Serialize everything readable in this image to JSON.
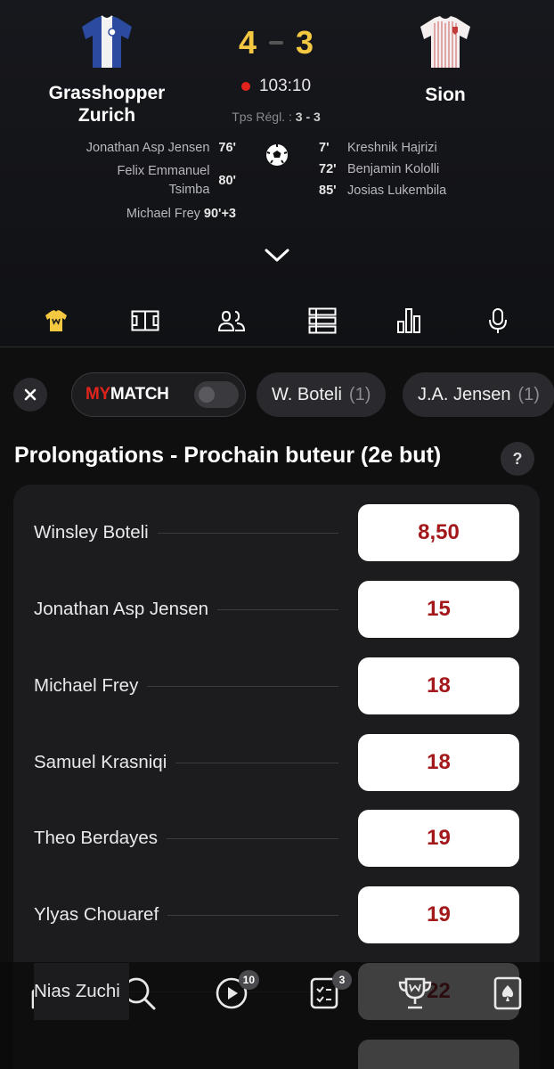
{
  "match": {
    "home_team": "Grasshopper Zurich",
    "away_team": "Sion",
    "home_score": "4",
    "away_score": "3",
    "clock": "103:10",
    "regulation_label": "Tps Régl. :",
    "regulation_score": "3 - 3",
    "home_scorers": [
      {
        "name": "Jonathan Asp Jensen",
        "minute": "76'"
      },
      {
        "name": "Felix Emmanuel Tsimba",
        "minute": "80'"
      },
      {
        "name": "Michael Frey",
        "minute": "90'+3"
      }
    ],
    "away_scorers": [
      {
        "name": "Kreshnik Hajrizi",
        "minute": "7'"
      },
      {
        "name": "Benjamin Kololli",
        "minute": "72'"
      },
      {
        "name": "Josias Lukembila",
        "minute": "85'"
      }
    ]
  },
  "tabs": [
    "jersey-icon",
    "pitch-icon",
    "lineups-icon",
    "standings-icon",
    "stats-icon",
    "microphone-icon"
  ],
  "filters": {
    "mymatch_prefix": "MY",
    "mymatch_suffix": "MATCH",
    "chips": [
      {
        "label": "W. Boteli",
        "count": "(1)"
      },
      {
        "label": "J.A. Jensen",
        "count": "(1)"
      }
    ]
  },
  "market": {
    "title": "Prolongations - Prochain buteur (2e but)",
    "help": "?",
    "selections": [
      {
        "name": "Winsley Boteli",
        "odd": "8,50"
      },
      {
        "name": "Jonathan Asp Jensen",
        "odd": "15"
      },
      {
        "name": "Michael Frey",
        "odd": "18"
      },
      {
        "name": "Samuel Krasniqi",
        "odd": "18"
      },
      {
        "name": "Theo Berdayes",
        "odd": "19"
      },
      {
        "name": "Ylyas Chouaref",
        "odd": "19"
      },
      {
        "name": "Nias Zuchi",
        "odd": "22"
      }
    ]
  },
  "bottom_nav": {
    "items": [
      "home-icon",
      "search-icon",
      "live-icon",
      "betslip-icon",
      "trophy-icon",
      "casino-icon"
    ],
    "live_badge": "10",
    "betslip_badge": "3"
  },
  "colors": {
    "accent": "#f5c842",
    "odd_text": "#a3181b",
    "live_dot": "#e0241c"
  }
}
